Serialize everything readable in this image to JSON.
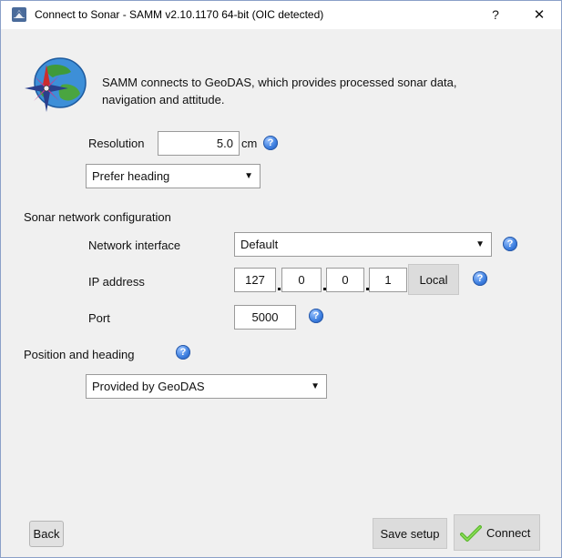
{
  "window": {
    "title": "Connect to Sonar - SAMM v2.10.1170 64-bit (OIC detected)",
    "help_glyph": "?",
    "close_glyph": "✕"
  },
  "intro": {
    "text_line1": "SAMM connects to GeoDAS, which provides processed sonar data,",
    "text_line2": "navigation and attitude.",
    "icon": "globe-compass-icon"
  },
  "resolution": {
    "label": "Resolution",
    "value": "5.0",
    "unit": "cm"
  },
  "heading_mode": {
    "selected": "Prefer heading"
  },
  "network": {
    "section_label": "Sonar network configuration",
    "interface_label": "Network interface",
    "interface_selected": "Default",
    "ip_label": "IP address",
    "ip_octets": [
      "127",
      "0",
      "0",
      "1"
    ],
    "local_button": "Local",
    "port_label": "Port",
    "port_value": "5000"
  },
  "position": {
    "section_label": "Position and heading",
    "selected": "Provided by GeoDAS"
  },
  "footer": {
    "back_label": "Back",
    "save_label": "Save setup",
    "connect_label": "Connect"
  },
  "help_icon_glyph": "?",
  "dropdown_glyph": "▼",
  "colors": {
    "help_blue": "#3d7fe0",
    "connect_check": "#5cb82e",
    "title_border": "#8aa0c8"
  }
}
